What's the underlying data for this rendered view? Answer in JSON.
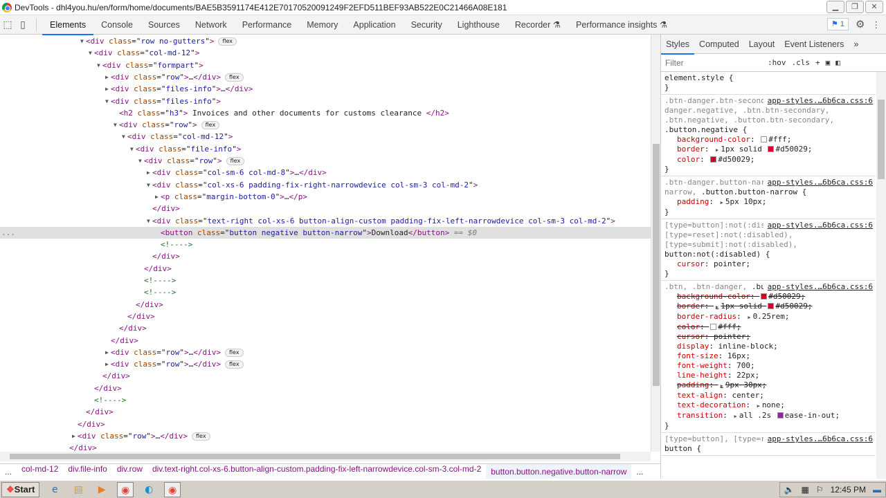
{
  "window": {
    "title": "DevTools - dhl4you.hu/en/form/home/documents/BAE5B3591174E412E70170520091249F2EFD511BEF93AB522E0C21466A08E181"
  },
  "tabs": [
    "Elements",
    "Console",
    "Sources",
    "Network",
    "Performance",
    "Memory",
    "Application",
    "Security",
    "Lighthouse",
    "Recorder",
    "Performance insights"
  ],
  "active_tab": "Elements",
  "issues_count": "1",
  "dom": [
    {
      "d": 0,
      "t": "open",
      "tag": "div",
      "attrs": [
        [
          "class",
          "row no-gutters"
        ]
      ],
      "badge": "flex"
    },
    {
      "d": 1,
      "t": "open",
      "tag": "div",
      "attrs": [
        [
          "class",
          "col-md-12"
        ]
      ]
    },
    {
      "d": 2,
      "t": "open",
      "tag": "div",
      "attrs": [
        [
          "class",
          "formpart"
        ]
      ]
    },
    {
      "d": 3,
      "t": "collapsed",
      "tag": "div",
      "attrs": [
        [
          "class",
          "row"
        ]
      ],
      "badge": "flex"
    },
    {
      "d": 3,
      "t": "collapsed",
      "tag": "div",
      "attrs": [
        [
          "class",
          "files-info"
        ]
      ]
    },
    {
      "d": 3,
      "t": "open",
      "tag": "div",
      "attrs": [
        [
          "class",
          "files-info"
        ]
      ]
    },
    {
      "d": 4,
      "t": "leaf",
      "tag": "h2",
      "attrs": [
        [
          "class",
          "h3"
        ]
      ],
      "content": " Invoices and other documents for customs clearance "
    },
    {
      "d": 4,
      "t": "open",
      "tag": "div",
      "attrs": [
        [
          "class",
          "row"
        ]
      ],
      "badge": "flex"
    },
    {
      "d": 5,
      "t": "open",
      "tag": "div",
      "attrs": [
        [
          "class",
          "col-md-12"
        ]
      ]
    },
    {
      "d": 6,
      "t": "open",
      "tag": "div",
      "attrs": [
        [
          "class",
          "file-info"
        ]
      ]
    },
    {
      "d": 7,
      "t": "open",
      "tag": "div",
      "attrs": [
        [
          "class",
          "row"
        ]
      ],
      "badge": "flex"
    },
    {
      "d": 8,
      "t": "collapsed",
      "tag": "div",
      "attrs": [
        [
          "class",
          "col-sm-6 col-md-8"
        ]
      ]
    },
    {
      "d": 8,
      "t": "open",
      "tag": "div",
      "attrs": [
        [
          "class",
          "col-xs-6 padding-fix-right-narrowdevice col-sm-3 col-md-2"
        ]
      ]
    },
    {
      "d": 9,
      "t": "collapsed",
      "tag": "p",
      "attrs": [
        [
          "class",
          "margin-bottom-0"
        ]
      ]
    },
    {
      "d": 8,
      "t": "close",
      "tag": "div"
    },
    {
      "d": 8,
      "t": "open",
      "tag": "div",
      "attrs": [
        [
          "class",
          "text-right col-xs-6 button-align-custom padding-fix-left-narrowdevice col-sm-3 col-md-2"
        ]
      ]
    },
    {
      "d": 9,
      "t": "leaf",
      "tag": "button",
      "attrs": [
        [
          "class",
          "button negative button-narrow"
        ]
      ],
      "content": "Download",
      "selected": true,
      "eq": " == $0"
    },
    {
      "d": 9,
      "t": "comment",
      "content": "<!---->"
    },
    {
      "d": 8,
      "t": "close",
      "tag": "div"
    },
    {
      "d": 7,
      "t": "close",
      "tag": "div"
    },
    {
      "d": 7,
      "t": "comment",
      "content": "<!---->"
    },
    {
      "d": 7,
      "t": "comment",
      "content": "<!---->"
    },
    {
      "d": 6,
      "t": "close",
      "tag": "div"
    },
    {
      "d": 5,
      "t": "close",
      "tag": "div"
    },
    {
      "d": 4,
      "t": "close",
      "tag": "div"
    },
    {
      "d": 3,
      "t": "close",
      "tag": "div"
    },
    {
      "d": 3,
      "t": "collapsed",
      "tag": "div",
      "attrs": [
        [
          "class",
          "row"
        ]
      ],
      "badge": "flex"
    },
    {
      "d": 3,
      "t": "collapsed",
      "tag": "div",
      "attrs": [
        [
          "class",
          "row"
        ]
      ],
      "badge": "flex"
    },
    {
      "d": 2,
      "t": "close",
      "tag": "div"
    },
    {
      "d": 1,
      "t": "close",
      "tag": "div"
    },
    {
      "d": 1,
      "t": "comment",
      "content": "<!---->"
    },
    {
      "d": 0,
      "t": "close",
      "tag": "div"
    },
    {
      "d": -1,
      "t": "close",
      "tag": "div"
    },
    {
      "d": -1,
      "t": "collapsed",
      "tag": "div",
      "attrs": [
        [
          "class",
          "row"
        ]
      ],
      "badge": "flex"
    },
    {
      "d": -2,
      "t": "close",
      "tag": "div"
    }
  ],
  "breadcrumbs": {
    "more": "...",
    "items": [
      "col-md-12",
      "div.file-info",
      "div.row",
      "div.text-right.col-xs-6.button-align-custom.padding-fix-left-narrowdevice.col-sm-3.col-md-2",
      "button.button.negative.button-narrow"
    ],
    "trail": "..."
  },
  "styles": {
    "tabs": [
      "Styles",
      "Computed",
      "Layout",
      "Event Listeners"
    ],
    "more": "»",
    "filter_placeholder": "Filter",
    "hov": ":hov",
    "cls": ".cls",
    "rules": [
      {
        "selector_dim": "",
        "selector": "element.style {",
        "source": "",
        "decls": []
      },
      {
        "selector_dim": ".btn-danger.btn-secondary, .btn-danger.negative, .btn.btn-secondary, .btn.negative, .button.btn-secondary, ",
        "selector": ".button.negative {",
        "source": "app-styles.…6b6ca.css:6",
        "decls": [
          {
            "n": "background-color",
            "v": "#fff;",
            "sw": "#ffffff"
          },
          {
            "n": "border",
            "v": "1px solid ",
            "sw": "#d50029",
            "v2": "#d50029;",
            "arrow": true
          },
          {
            "n": "color",
            "v": "#d50029;",
            "sw": "#d50029"
          }
        ]
      },
      {
        "selector_dim": ".btn-danger.button-narrow, .btn.button-narrow, ",
        "selector": ".button.button-narrow {",
        "source": "app-styles.…6b6ca.css:6",
        "decls": [
          {
            "n": "padding",
            "v": "5px 10px;",
            "arrow": true
          }
        ]
      },
      {
        "selector_dim": "[type=button]:not(:disabled), [type=reset]:not(:disabled), [type=submit]:not(:disabled), ",
        "selector": "button:not(:disabled) {",
        "source": "app-styles.…6b6ca.css:6",
        "decls": [
          {
            "n": "cursor",
            "v": "pointer;"
          }
        ]
      },
      {
        "selector_dim": ".btn, .btn-danger, ",
        "selector": ".button {",
        "source": "app-styles.…6b6ca.css:6",
        "decls": [
          {
            "n": "background-color",
            "v": "#d50029;",
            "sw": "#d50029",
            "strike": true
          },
          {
            "n": "border",
            "v": "1px solid ",
            "sw": "#d50029",
            "v2": "#d50029;",
            "arrow": true,
            "strike": true
          },
          {
            "n": "border-radius",
            "v": "0.25rem;",
            "arrow": true
          },
          {
            "n": "color",
            "v": "#fff;",
            "sw": "#ffffff",
            "strike": true
          },
          {
            "n": "cursor",
            "v": "pointer;",
            "strike": true
          },
          {
            "n": "display",
            "v": "inline-block;"
          },
          {
            "n": "font-size",
            "v": "16px;"
          },
          {
            "n": "font-weight",
            "v": "700;"
          },
          {
            "n": "line-height",
            "v": "22px;"
          },
          {
            "n": "padding",
            "v": "9px 30px;",
            "arrow": true,
            "strike": true
          },
          {
            "n": "text-align",
            "v": "center;"
          },
          {
            "n": "text-decoration",
            "v": "none;",
            "arrow": true
          },
          {
            "n": "transition",
            "v": "all .2s ",
            "sw": "#8e24aa",
            "v2": "ease-in-out;",
            "arrow": true
          }
        ]
      },
      {
        "selector_dim": "[type=button], [type=reset], [type=submit], ",
        "selector": "button {",
        "source": "app-styles.…6b6ca.css:6",
        "decls": []
      }
    ]
  },
  "taskbar": {
    "start": "Start",
    "clock": "12:45 PM"
  }
}
